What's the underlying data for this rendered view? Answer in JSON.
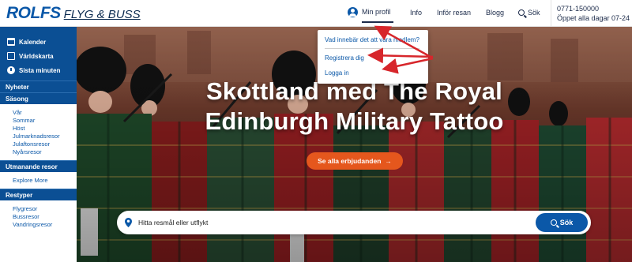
{
  "header": {
    "logo_main": "ROLFS",
    "logo_sub": "FLYG & BUSS",
    "nav": {
      "profile": "Min profil",
      "info": "Info",
      "before_trip": "Inför resan",
      "blog": "Blogg",
      "search": "Sök"
    },
    "phone": "0771-150000",
    "hours": "Öppet alla dagar 07-24"
  },
  "profile_dropdown": {
    "items": [
      "Vad innebär det att vara medlem?",
      "Registrera dig",
      "Logga in"
    ]
  },
  "sidebar": {
    "top_links": [
      {
        "label": "Kalender",
        "icon": "calendar-icon"
      },
      {
        "label": "Världskarta",
        "icon": "map-icon"
      },
      {
        "label": "Sista minuten",
        "icon": "clock-icon"
      }
    ],
    "sections": [
      {
        "title": "Nyheter",
        "items": []
      },
      {
        "title": "Säsong",
        "items": [
          "Vår",
          "Sommar",
          "Höst",
          "Julmarknadsresor",
          "Julaftonsresor",
          "Nyårsresor"
        ]
      },
      {
        "title": "Utmanande resor",
        "items": [
          "Explore More"
        ]
      },
      {
        "title": "Restyper",
        "items": [
          "Flygresor",
          "Bussresor",
          "Vandringsresor"
        ]
      }
    ]
  },
  "hero": {
    "title_line1": "Skottland med The Royal",
    "title_line2": "Edinburgh Military Tattoo",
    "cta": "Se alla erbjudanden",
    "cta_icon": "arrow-right-icon"
  },
  "search": {
    "placeholder": "Hitta resmål eller utflykt",
    "button": "Sök"
  },
  "colors": {
    "brand_blue": "#0b58a8",
    "sidebar_blue": "#0b4f94",
    "cta_orange": "#e5571d",
    "annotation_red": "#d7262b"
  }
}
